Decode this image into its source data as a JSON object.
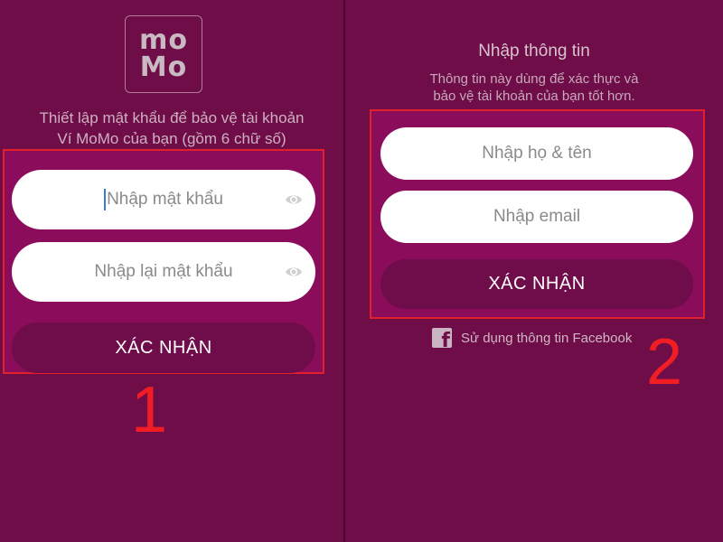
{
  "left_screen": {
    "logo_line1": "mo",
    "logo_line2": "Mo",
    "instruction_line1": "Thiết lập mật khẩu để bảo vệ tài khoản",
    "instruction_line2": "Ví MoMo của bạn (gồm 6 chữ số)",
    "password_placeholder": "Nhập mật khẩu",
    "confirm_password_placeholder": "Nhập lại mật khẩu",
    "confirm_button": "XÁC NHẬN",
    "step_number": "1",
    "eye_icon": "eye-icon"
  },
  "right_screen": {
    "title": "Nhập thông tin",
    "subtitle_line1": "Thông tin này dùng để xác thực và",
    "subtitle_line2": "bảo vệ tài khoản của bạn tốt hơn.",
    "name_placeholder": "Nhập họ & tên",
    "email_placeholder": "Nhập email",
    "confirm_button": "XÁC NHẬN",
    "facebook_link": "Sử dụng thông tin Facebook",
    "facebook_icon": "facebook-icon",
    "step_number": "2"
  },
  "colors": {
    "background": "#6e0d47",
    "highlight_box": "#8c0c5c",
    "annotation_red": "#e0202a",
    "button": "#6f0c4a"
  }
}
